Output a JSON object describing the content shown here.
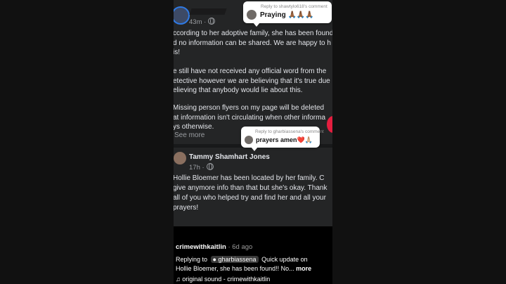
{
  "post1": {
    "timestamp": "43m ·",
    "lines1": [
      "ccording to her adoptive family, she has been found",
      "d no information can be shared. We are happy to h",
      "is!"
    ],
    "lines2": [
      "e still have not received any official word from the",
      "etective however we are believing that it's true due",
      "elieving that anybody would lie about this."
    ],
    "lines3": [
      "Missing person flyers on my page will be deleted",
      "at information isn't circulating when other informa",
      "ys otherwise."
    ],
    "see_more": "See more"
  },
  "post2": {
    "author": "Tammy Shamhart Jones",
    "timestamp": "17h ·",
    "lines": [
      "Hollie Bloemer has been located by her family.    C",
      "give anymore info than that but she's okay.  Thank",
      "all of you who helped try and find her and all your",
      "prayers!"
    ]
  },
  "comment1": {
    "reply_to": "Reply to shawtylo618's comment",
    "text": "Praying 🙏🏾🙏🏾🙏🏾"
  },
  "comment2": {
    "reply_to": "Reply to gharbiassena's comment",
    "text": "prayers amen❤️🙏🏼"
  },
  "tiktok": {
    "username": "crimewithkaitlin",
    "age": "· 6d ago",
    "replying_prefix": "Replying to",
    "replying_user": "gharbiassena",
    "caption_rest": "Quick update on",
    "caption_line2": "Hollie Bloemer, she has been found!! No...",
    "more": "more",
    "sound": "original sound - crimewithkaitlin"
  },
  "icons": [
    "globe-icon",
    "music-note-icon",
    "comment-icon"
  ],
  "colors": {
    "post_bg": "#242526",
    "reaction_red": "#e41e3f"
  }
}
